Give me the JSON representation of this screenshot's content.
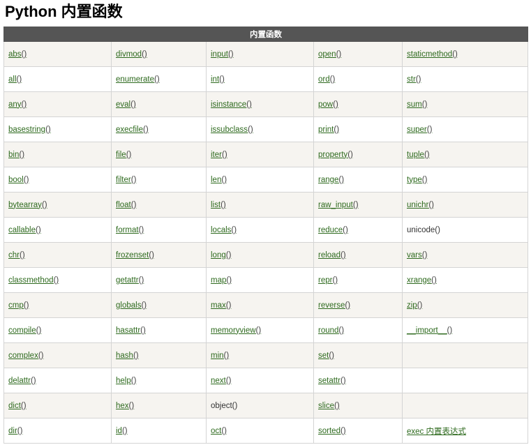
{
  "title": "Python 内置函数",
  "table": {
    "header": "内置函数",
    "rows": [
      [
        {
          "name": "abs",
          "suffix": "()",
          "link": true
        },
        {
          "name": "divmod",
          "suffix": "()",
          "link": true
        },
        {
          "name": "input",
          "suffix": "()",
          "link": true
        },
        {
          "name": "open",
          "suffix": "()",
          "link": true
        },
        {
          "name": "staticmethod",
          "suffix": "()",
          "link": true
        }
      ],
      [
        {
          "name": "all",
          "suffix": "()",
          "link": true
        },
        {
          "name": "enumerate",
          "suffix": "()",
          "link": true
        },
        {
          "name": "int",
          "suffix": "()",
          "link": true
        },
        {
          "name": "ord",
          "suffix": "()",
          "link": true
        },
        {
          "name": "str",
          "suffix": "()",
          "link": true
        }
      ],
      [
        {
          "name": "any",
          "suffix": "()",
          "link": true
        },
        {
          "name": "eval",
          "suffix": "()",
          "link": true
        },
        {
          "name": "isinstance",
          "suffix": "()",
          "link": true
        },
        {
          "name": "pow",
          "suffix": "()",
          "link": true
        },
        {
          "name": "sum",
          "suffix": "()",
          "link": true
        }
      ],
      [
        {
          "name": "basestring",
          "suffix": "()",
          "link": true
        },
        {
          "name": "execfile",
          "suffix": "()",
          "link": true
        },
        {
          "name": "issubclass",
          "suffix": "()",
          "link": true
        },
        {
          "name": "print",
          "suffix": "()",
          "link": true
        },
        {
          "name": "super",
          "suffix": "()",
          "link": true
        }
      ],
      [
        {
          "name": "bin",
          "suffix": "()",
          "link": true
        },
        {
          "name": "file",
          "suffix": "()",
          "link": true
        },
        {
          "name": "iter",
          "suffix": "()",
          "link": true
        },
        {
          "name": "property",
          "suffix": "()",
          "link": true
        },
        {
          "name": "tuple",
          "suffix": "()",
          "link": true
        }
      ],
      [
        {
          "name": "bool",
          "suffix": "()",
          "link": true
        },
        {
          "name": "filter",
          "suffix": "()",
          "link": true
        },
        {
          "name": "len",
          "suffix": "()",
          "link": true
        },
        {
          "name": "range",
          "suffix": "()",
          "link": true
        },
        {
          "name": "type",
          "suffix": "()",
          "link": true
        }
      ],
      [
        {
          "name": "bytearray",
          "suffix": "()",
          "link": true
        },
        {
          "name": "float",
          "suffix": "()",
          "link": true
        },
        {
          "name": "list",
          "suffix": "()",
          "link": true
        },
        {
          "name": "raw_input",
          "suffix": "()",
          "link": true
        },
        {
          "name": "unichr",
          "suffix": "()",
          "link": true
        }
      ],
      [
        {
          "name": "callable",
          "suffix": "()",
          "link": true
        },
        {
          "name": "format",
          "suffix": "()",
          "link": true
        },
        {
          "name": "locals",
          "suffix": "()",
          "link": true
        },
        {
          "name": "reduce",
          "suffix": "()",
          "link": true
        },
        {
          "name": "unicode()",
          "suffix": "",
          "link": false
        }
      ],
      [
        {
          "name": "chr",
          "suffix": "()",
          "link": true
        },
        {
          "name": "frozenset",
          "suffix": "()",
          "link": true
        },
        {
          "name": "long",
          "suffix": "()",
          "link": true
        },
        {
          "name": "reload",
          "suffix": "()",
          "link": true
        },
        {
          "name": "vars",
          "suffix": "()",
          "link": true
        }
      ],
      [
        {
          "name": "classmethod",
          "suffix": "()",
          "link": true
        },
        {
          "name": "getattr",
          "suffix": "()",
          "link": true
        },
        {
          "name": "map",
          "suffix": "()",
          "link": true
        },
        {
          "name": "repr",
          "suffix": "()",
          "link": true
        },
        {
          "name": "xrange",
          "suffix": "()",
          "link": true
        }
      ],
      [
        {
          "name": "cmp",
          "suffix": "()",
          "link": true
        },
        {
          "name": "globals",
          "suffix": "()",
          "link": true
        },
        {
          "name": "max",
          "suffix": "()",
          "link": true
        },
        {
          "name": "reverse",
          "suffix": "()",
          "link": true
        },
        {
          "name": "zip",
          "suffix": "()",
          "link": true
        }
      ],
      [
        {
          "name": "compile",
          "suffix": "()",
          "link": true
        },
        {
          "name": "hasattr",
          "suffix": "()",
          "link": true
        },
        {
          "name": "memoryview",
          "suffix": "()",
          "link": true
        },
        {
          "name": "round",
          "suffix": "()",
          "link": true
        },
        {
          "name": "__import__",
          "suffix": "()",
          "link": true
        }
      ],
      [
        {
          "name": "complex",
          "suffix": "()",
          "link": true
        },
        {
          "name": "hash",
          "suffix": "()",
          "link": true
        },
        {
          "name": "min",
          "suffix": "()",
          "link": true
        },
        {
          "name": "set",
          "suffix": "()",
          "link": true
        },
        null
      ],
      [
        {
          "name": "delattr",
          "suffix": "()",
          "link": true
        },
        {
          "name": "help",
          "suffix": "()",
          "link": true
        },
        {
          "name": "next",
          "suffix": "()",
          "link": true
        },
        {
          "name": "setattr",
          "suffix": "()",
          "link": true
        },
        null
      ],
      [
        {
          "name": "dict",
          "suffix": "()",
          "link": true
        },
        {
          "name": "hex",
          "suffix": "()",
          "link": true
        },
        {
          "name": "object()",
          "suffix": "",
          "link": false
        },
        {
          "name": "slice",
          "suffix": "()",
          "link": true
        },
        null
      ],
      [
        {
          "name": "dir",
          "suffix": "()",
          "link": true
        },
        {
          "name": "id",
          "suffix": "()",
          "link": true
        },
        {
          "name": "oct",
          "suffix": "()",
          "link": true
        },
        {
          "name": "sorted",
          "suffix": "()",
          "link": true
        },
        {
          "name": "exec 内置表达式",
          "suffix": "",
          "link": true
        }
      ]
    ]
  }
}
